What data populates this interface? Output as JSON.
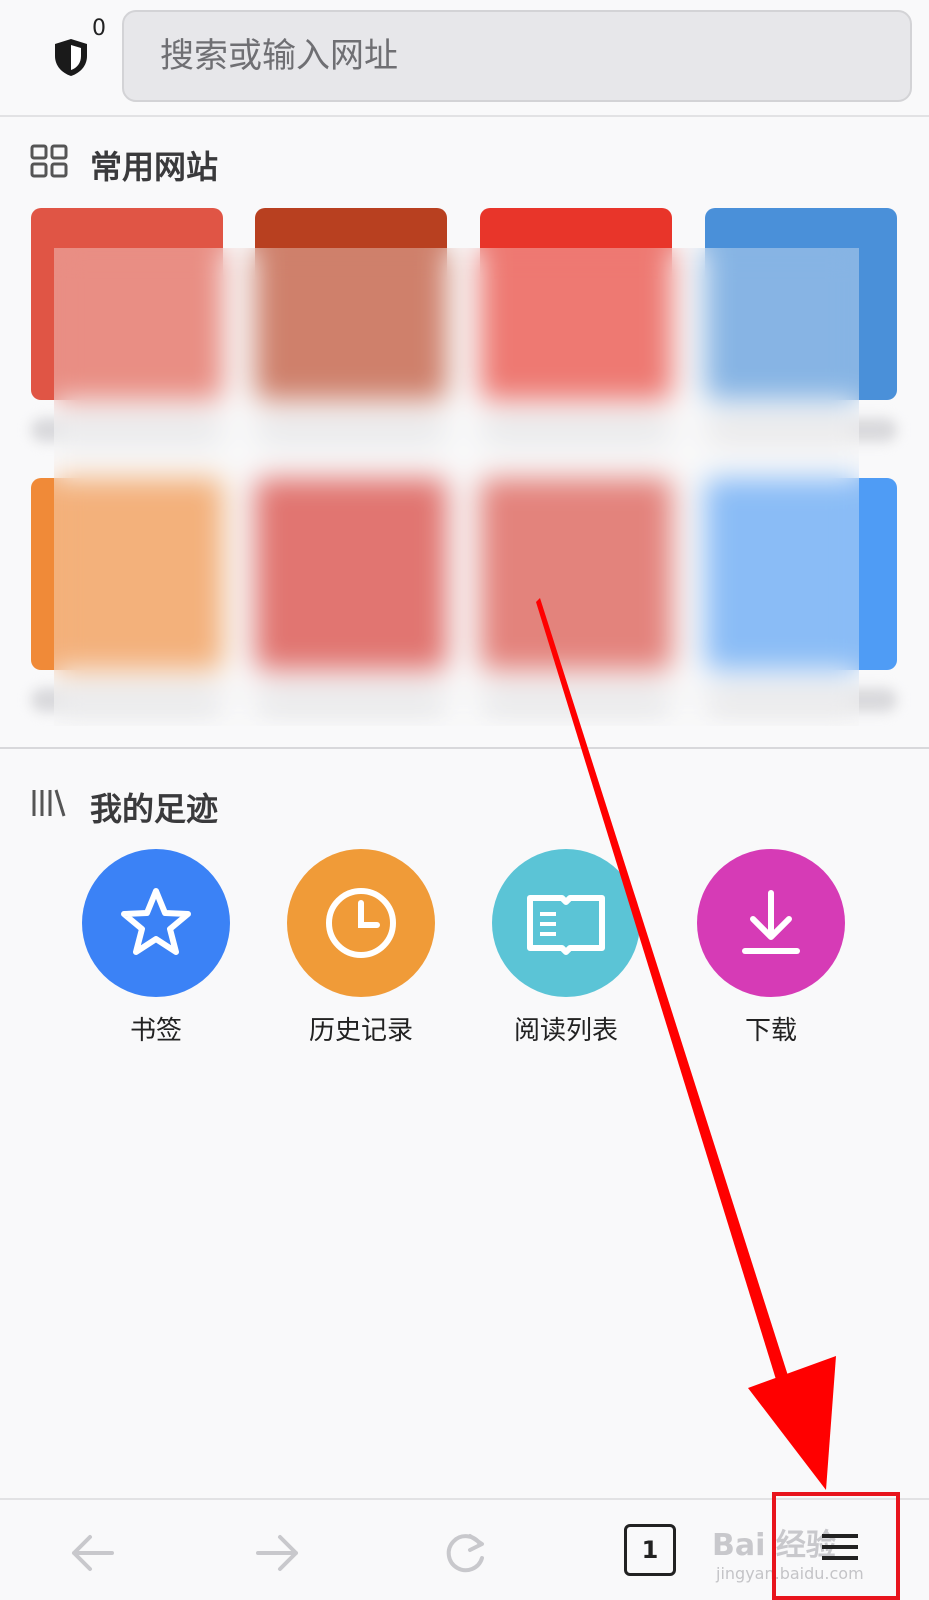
{
  "header": {
    "tracker_count": "0",
    "search_placeholder": "搜索或输入网址"
  },
  "top_sites": {
    "title": "常用网站",
    "tiles": [
      {
        "color": "#e05545"
      },
      {
        "color": "#b84020"
      },
      {
        "color": "#e8352a"
      },
      {
        "color": "#4a90d9"
      },
      {
        "color": "#f08a38"
      },
      {
        "color": "#d42f28"
      },
      {
        "color": "#d8443a"
      },
      {
        "color": "#4f9cf5"
      }
    ]
  },
  "footprints": {
    "title": "我的足迹",
    "items": [
      {
        "label": "书签",
        "icon": "star-icon",
        "color": "#3b82f6"
      },
      {
        "label": "历史记录",
        "icon": "clock-icon",
        "color": "#f09b38"
      },
      {
        "label": "阅读列表",
        "icon": "book-icon",
        "color": "#5bc4d6"
      },
      {
        "label": "下载",
        "icon": "download-icon",
        "color": "#d63bb6"
      }
    ]
  },
  "toolbar": {
    "tab_count": "1",
    "watermark": "Bai 经验",
    "watermark_sub": "jingyan.baidu.com"
  },
  "annotation_color": "#ff0000"
}
